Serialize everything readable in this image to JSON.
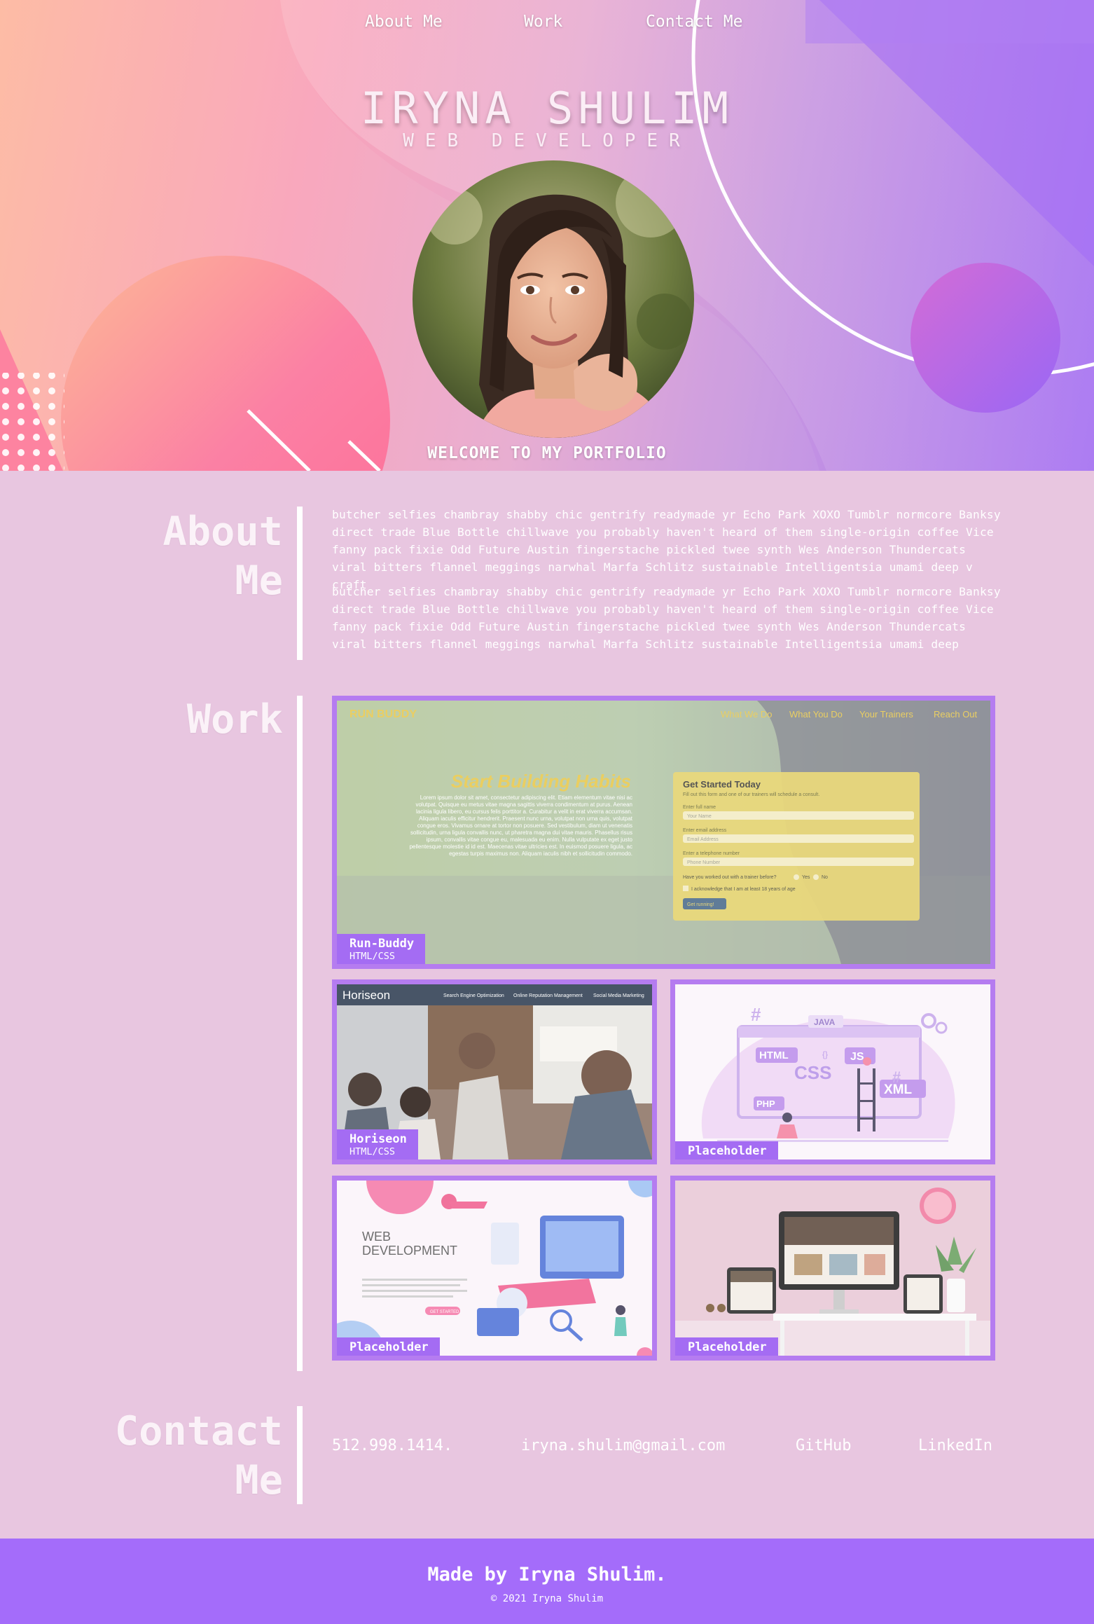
{
  "nav": {
    "items": [
      {
        "label": "About Me"
      },
      {
        "label": "Work"
      },
      {
        "label": "Contact Me"
      }
    ]
  },
  "hero": {
    "name": "IRYNA SHULIM",
    "role": "WEB DEVELOPER",
    "welcome": "WELCOME TO MY PORTFOLIO"
  },
  "about": {
    "title_line1": "About",
    "title_line2": "Me",
    "paragraphs": [
      "butcher selfies chambray shabby chic gentrify readymade yr Echo Park XOXO Tumblr normcore Banksy direct trade Blue Bottle chillwave you probably haven't heard of them single-origin coffee Vice fanny pack fixie Odd Future Austin fingerstache pickled twee synth Wes Anderson Thundercats viral bitters flannel meggings narwhal Marfa Schlitz sustainable Intelligentsia umami deep v craft",
      "butcher selfies chambray shabby chic gentrify readymade yr Echo Park XOXO Tumblr normcore Banksy direct trade Blue Bottle chillwave you probably haven't heard of them single-origin coffee Vice fanny pack fixie Odd Future Austin fingerstache pickled twee synth Wes Anderson Thundercats viral bitters flannel meggings narwhal Marfa Schlitz sustainable Intelligentsia umami deep"
    ]
  },
  "work": {
    "title": "Work",
    "projects": [
      {
        "name": "Run-Buddy",
        "tech": "HTML/CSS",
        "shot": {
          "brand": "RUN BUDDY",
          "nav": [
            "What We Do",
            "What You Do",
            "Your Trainers",
            "Reach Out"
          ],
          "headline": "Start Building Habits",
          "lorem": "Lorem ipsum dolor sit amet, consectetur adipiscing elit. Etiam elementum vitae nisi ac volutpat. Quisque eu metus vitae magna sagittis viverra condimentum at purus. Aenean lacinia ligula libero, eu cursus felis porttitor a. Curabitur a velit in erat viverra accumsan. Aliquam iaculis efficitur hendrerit. Praesent nunc urna, volutpat non urna quis, volutpat congue eros. Vivamus ornare at tortor non posuere. Sed vestibulum, diam ut venenatis sollicitudin, urna ligula convallis nunc, ut pharetra magna dui vitae mauris. Phasellus risus ipsum, convallis vitae congue eu, malesuada eu enim. Nulla vulputate ex eget justo pellentesque molestie id id est. Maecenas vitae ultricies est. In euismod posuere ligula, ac egestas turpis maximus non. Aliquam iaculis nibh et sollicitudin commodo.",
          "form_title": "Get Started Today",
          "form_sub": "Fill out this form and one of our trainers will schedule a consult.",
          "fields": [
            {
              "label": "Enter full name",
              "placeholder": "Your Name"
            },
            {
              "label": "Enter email address",
              "placeholder": "Email Address"
            },
            {
              "label": "Enter a telephone number",
              "placeholder": "Phone Number"
            }
          ],
          "question": "Have you worked out with a trainer before?",
          "yes": "Yes",
          "no": "No",
          "ack": "I acknowledge that I am at least 18 years of age",
          "cta": "Get running!"
        }
      },
      {
        "name": "Horiseon",
        "tech": "HTML/CSS",
        "shot": {
          "brand": "Horiseon",
          "nav": [
            "Search Engine Optimization",
            "Online Reputation Management",
            "Social Media Marketing"
          ]
        }
      },
      {
        "name": "Placeholder",
        "shot": {
          "tags": [
            "JAVA",
            "HTML",
            "JS",
            "CSS",
            "PHP",
            "XML",
            "{}"
          ]
        }
      },
      {
        "name": "Placeholder",
        "shot": {
          "heading_line1": "WEB",
          "heading_line2": "DEVELOPMENT",
          "cta": "GET STARTED"
        }
      },
      {
        "name": "Placeholder"
      }
    ]
  },
  "contact": {
    "title_line1": "Contact",
    "title_line2": "Me",
    "phone": "512.998.1414.",
    "email": "iryna.shulim@gmail.com",
    "github": "GitHub",
    "linkedin": "LinkedIn"
  },
  "footer": {
    "made_by": "Made by Iryna Shulim.",
    "copyright": "© 2021 Iryna Shulim"
  },
  "colors": {
    "accent": "#a46cfa",
    "card_border": "#b57cf0",
    "page_bg": "#e8c6e0"
  }
}
